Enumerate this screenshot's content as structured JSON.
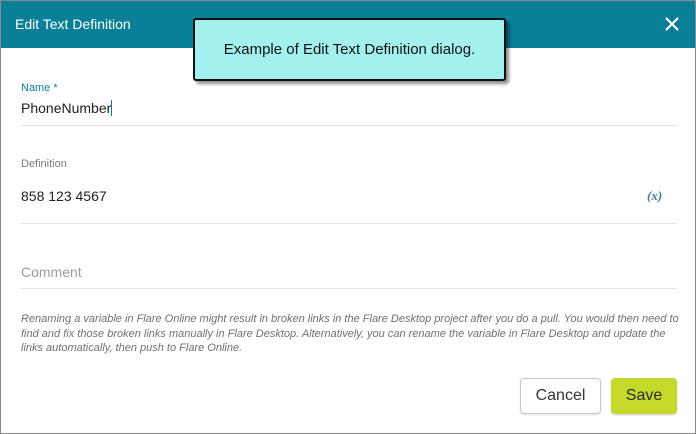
{
  "dialog": {
    "title": "Edit Text Definition",
    "close_icon": "close-icon"
  },
  "callout": {
    "text": "Example of Edit Text Definition dialog."
  },
  "form": {
    "name_label": "Name *",
    "name_value": "PhoneNumber",
    "definition_label": "Definition",
    "definition_value": "858 123 4567",
    "variable_button_label": "(x)",
    "comment_placeholder": "Comment"
  },
  "note": "Renaming a variable in Flare Online might result in broken links in the Flare Desktop project after you do a pull. You would then need to find and fix those broken links manually in Flare Desktop. Alternatively, you can rename the variable in Flare Desktop and update the links automatically, then push to Flare Online.",
  "buttons": {
    "cancel": "Cancel",
    "save": "Save"
  },
  "colors": {
    "header": "#0a7f98",
    "callout_bg": "#a3f1ef",
    "save_bg": "#c5d92b"
  }
}
